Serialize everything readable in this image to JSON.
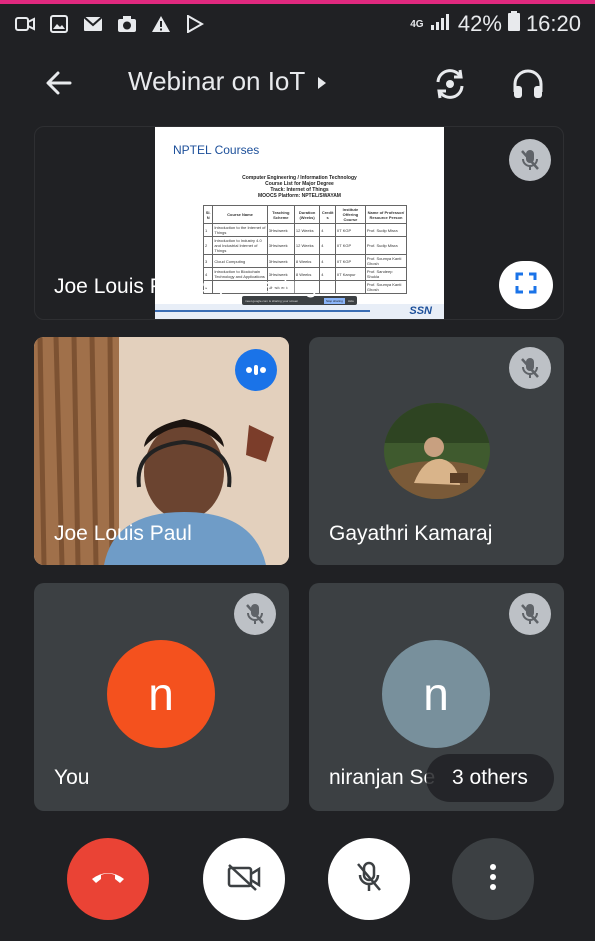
{
  "status": {
    "network": "4G",
    "battery": "42%",
    "time": "16:20"
  },
  "header": {
    "title": "Webinar on IoT"
  },
  "presentation": {
    "presenter_label": "Joe Louis Paul is presenting",
    "slide": {
      "brand": "NPTEL Courses",
      "line1": "Computer Engineering / Information Technology",
      "line2": "Course List for Major Degree",
      "line3": "Track: Internet of Things",
      "line4": "MOOCS Platform: NPTEL/SWAYAM",
      "columns": [
        "Sl. N",
        "Course Name",
        "Teaching Scheme",
        "Duration (Weeks)",
        "Credit s",
        "Institute Offering Course",
        "Name of Professor/ Resource Person"
      ],
      "rows": [
        [
          "1",
          "Introduction to the Internet of Things",
          "3Hrs/week",
          "12 Weeks",
          "4",
          "IIT KGP",
          "Prof. Sudip Misra"
        ],
        [
          "2",
          "Introduction to Industry 4.0 and Industrial Internet of Things",
          "3Hrs/week",
          "12 Weeks",
          "4",
          "IIT KGP",
          "Prof. Sudip Misra"
        ],
        [
          "3",
          "Cloud Computing",
          "3Hrs/week",
          "8 Weeks",
          "4",
          "IIT KGP",
          "Prof. Soumya Kanti Ghosh"
        ],
        [
          "4",
          "Introduction to Blockchain Technology and Applications",
          "3Hrs/week",
          "8 Weeks",
          "4",
          "IIT Kanpur",
          "Prof. Sandeep Shukla"
        ],
        [
          "5",
          "",
          "3Hrs/week",
          "",
          "",
          "",
          "Prof. Soumya Kanti Ghosh"
        ]
      ],
      "logo": "SSN",
      "share_bar_text": "meet.google.com is sharing your screen",
      "share_bar_button": "Stop sharing",
      "share_bar_hide": "Hide"
    }
  },
  "participants": [
    {
      "name": "Joe Louis Paul",
      "type": "video"
    },
    {
      "name": "Gayathri Kamaraj",
      "type": "image"
    },
    {
      "name": "You",
      "type": "initial",
      "initial": "n",
      "color": "#f4511e"
    },
    {
      "name": "niranjan Se",
      "type": "initial",
      "initial": "n",
      "color": "#78909c"
    }
  ],
  "others_label": "3 others",
  "colors": {
    "background": "#202124",
    "tile": "#3c4043",
    "end_call": "#ea4335",
    "accent_blue": "#1a73e8"
  },
  "icons": {
    "controls": [
      "end-call-icon",
      "camera-off-icon",
      "mic-off-icon",
      "more-vert-icon"
    ]
  }
}
